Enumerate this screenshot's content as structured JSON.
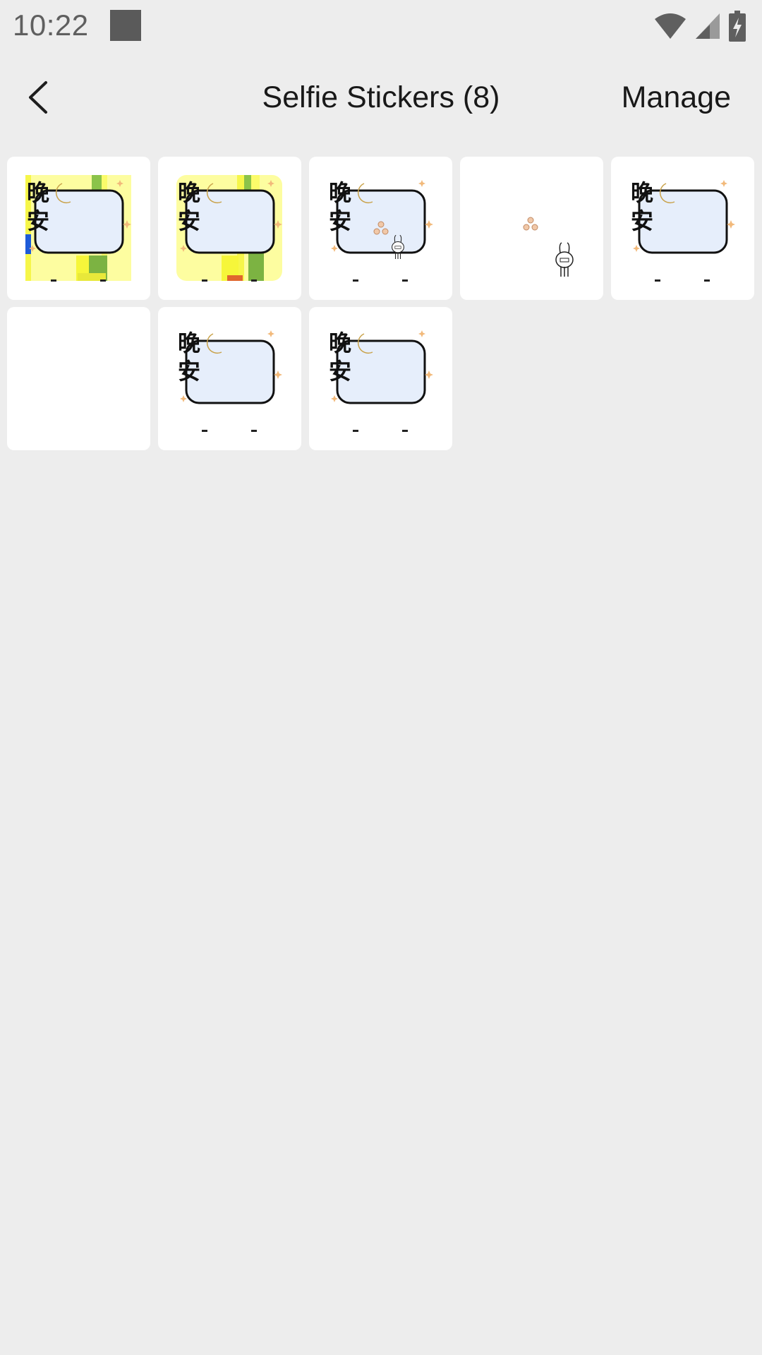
{
  "status_bar": {
    "time": "10:22"
  },
  "header": {
    "title": "Selfie Stickers (8)",
    "manage_label": "Manage"
  },
  "stickers": [
    {
      "kind": "goodnight-frame-yellow"
    },
    {
      "kind": "goodnight-frame-yellow"
    },
    {
      "kind": "goodnight-frame-rabbit"
    },
    {
      "kind": "rabbit-gesture"
    },
    {
      "kind": "goodnight-frame"
    },
    {
      "kind": "blank"
    },
    {
      "kind": "goodnight-frame"
    },
    {
      "kind": "goodnight-frame"
    }
  ],
  "sticker_text": "晚安",
  "icons": {
    "back": "back-arrow-icon",
    "wifi": "wifi-icon",
    "signal": "cell-signal-icon",
    "battery": "battery-charging-icon"
  },
  "colors": {
    "background": "#ededed",
    "card": "#ffffff",
    "frame_fill": "#e6eefb",
    "moon": "#f5d27a",
    "sparkle": "#f2b97a"
  }
}
